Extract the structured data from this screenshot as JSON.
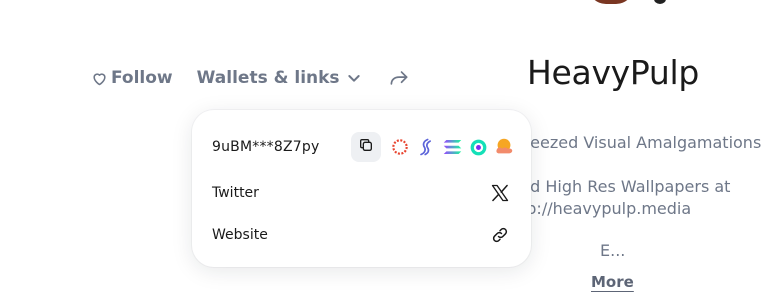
{
  "colors": {
    "muted_text": "#6e7788",
    "title_text": "#1a1a1a",
    "popover_bg": "#ffffff",
    "copy_button_bg": "#eef0f3"
  },
  "actions": {
    "follow_label": "Follow",
    "wallets_label": "Wallets & links",
    "follow_icon": "heart-outline-icon",
    "wallets_icon": "chevron-down-icon",
    "share_icon": "share-arrow-icon"
  },
  "profile": {
    "title": "HeavyPulp",
    "bio_lines": [
      "ueezed Visual Amalgamations",
      "nd High Res Wallpapers at",
      "tp://heavypulp.media",
      "E..."
    ],
    "more_label": "More"
  },
  "popover": {
    "wallet": {
      "address": "9uBM***8Z7py",
      "copy_icon": "copy-icon",
      "chains": [
        "ring-dots-icon",
        "feather-swirl-icon",
        "solana-icon",
        "circle-target-icon",
        "sun-cloud-icon"
      ]
    },
    "links": [
      {
        "label": "Twitter",
        "icon": "x-twitter-icon"
      },
      {
        "label": "Website",
        "icon": "link-icon"
      }
    ]
  }
}
